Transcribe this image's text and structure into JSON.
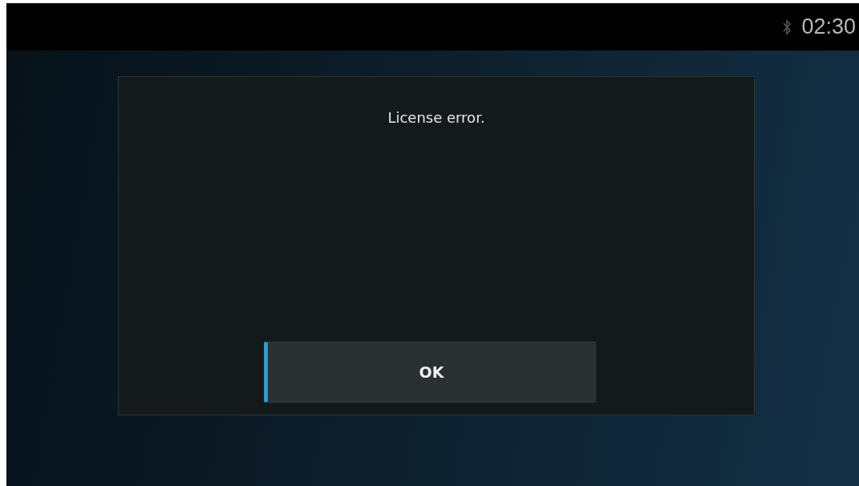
{
  "status_bar": {
    "bluetooth": true,
    "time": "02:30"
  },
  "dialog": {
    "message": "License error.",
    "buttons": [
      {
        "label": "OK",
        "focused": true
      }
    ]
  }
}
